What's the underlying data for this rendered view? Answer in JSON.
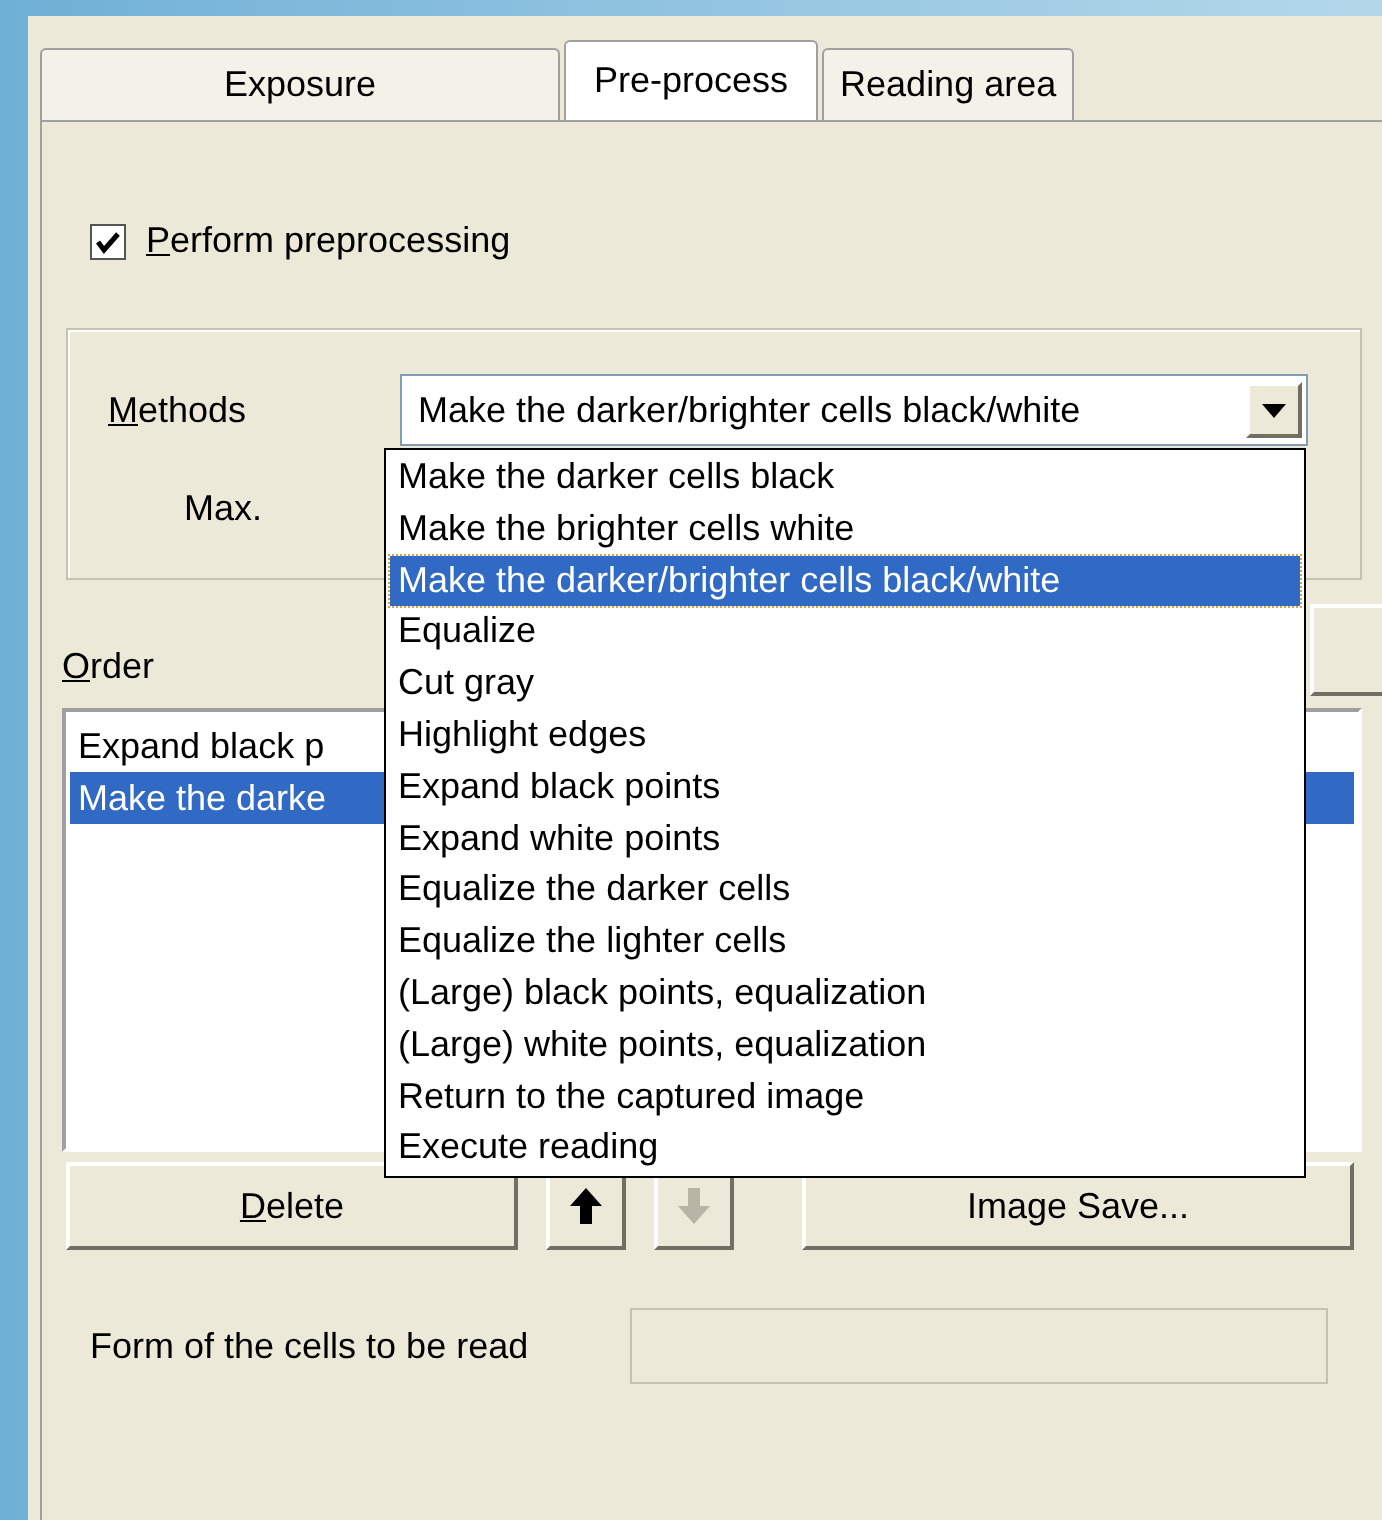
{
  "tabs": [
    {
      "label": "Exposure",
      "selected": false
    },
    {
      "label": "Pre-process",
      "selected": true
    },
    {
      "label": "Reading area",
      "selected": false
    }
  ],
  "perform": {
    "label": "Perform preprocessing",
    "checked": true
  },
  "methods": {
    "label": "Methods",
    "value": "Make the darker/brighter cells black/white"
  },
  "max": {
    "label": "Max."
  },
  "dropdown": [
    {
      "label": "Make the darker cells black",
      "selected": false
    },
    {
      "label": "Make the brighter cells white",
      "selected": false
    },
    {
      "label": "Make the darker/brighter cells black/white",
      "selected": true
    },
    {
      "label": "Equalize",
      "selected": false
    },
    {
      "label": "Cut gray",
      "selected": false
    },
    {
      "label": "Highlight edges",
      "selected": false
    },
    {
      "label": "Expand black points",
      "selected": false
    },
    {
      "label": "Expand white points",
      "selected": false
    },
    {
      "label": "Equalize the darker cells",
      "selected": false
    },
    {
      "label": "Equalize the lighter cells",
      "selected": false
    },
    {
      "label": "(Large) black points, equalization",
      "selected": false
    },
    {
      "label": "(Large) white points, equalization",
      "selected": false
    },
    {
      "label": "Return to the captured image",
      "selected": false
    },
    {
      "label": "Execute reading",
      "selected": false
    }
  ],
  "order": {
    "label": "Order",
    "items": [
      {
        "label": "Expand black p",
        "selected": false
      },
      {
        "label": "Make the darke",
        "selected": true
      }
    ]
  },
  "buttons": [
    {
      "kind": "text",
      "label": "Delete",
      "disabled": false
    },
    {
      "kind": "up",
      "disabled": false
    },
    {
      "kind": "down",
      "disabled": true
    },
    {
      "kind": "text",
      "label": "Image Save...",
      "disabled": false
    }
  ],
  "form": {
    "label": "Form of the cells to be read"
  }
}
